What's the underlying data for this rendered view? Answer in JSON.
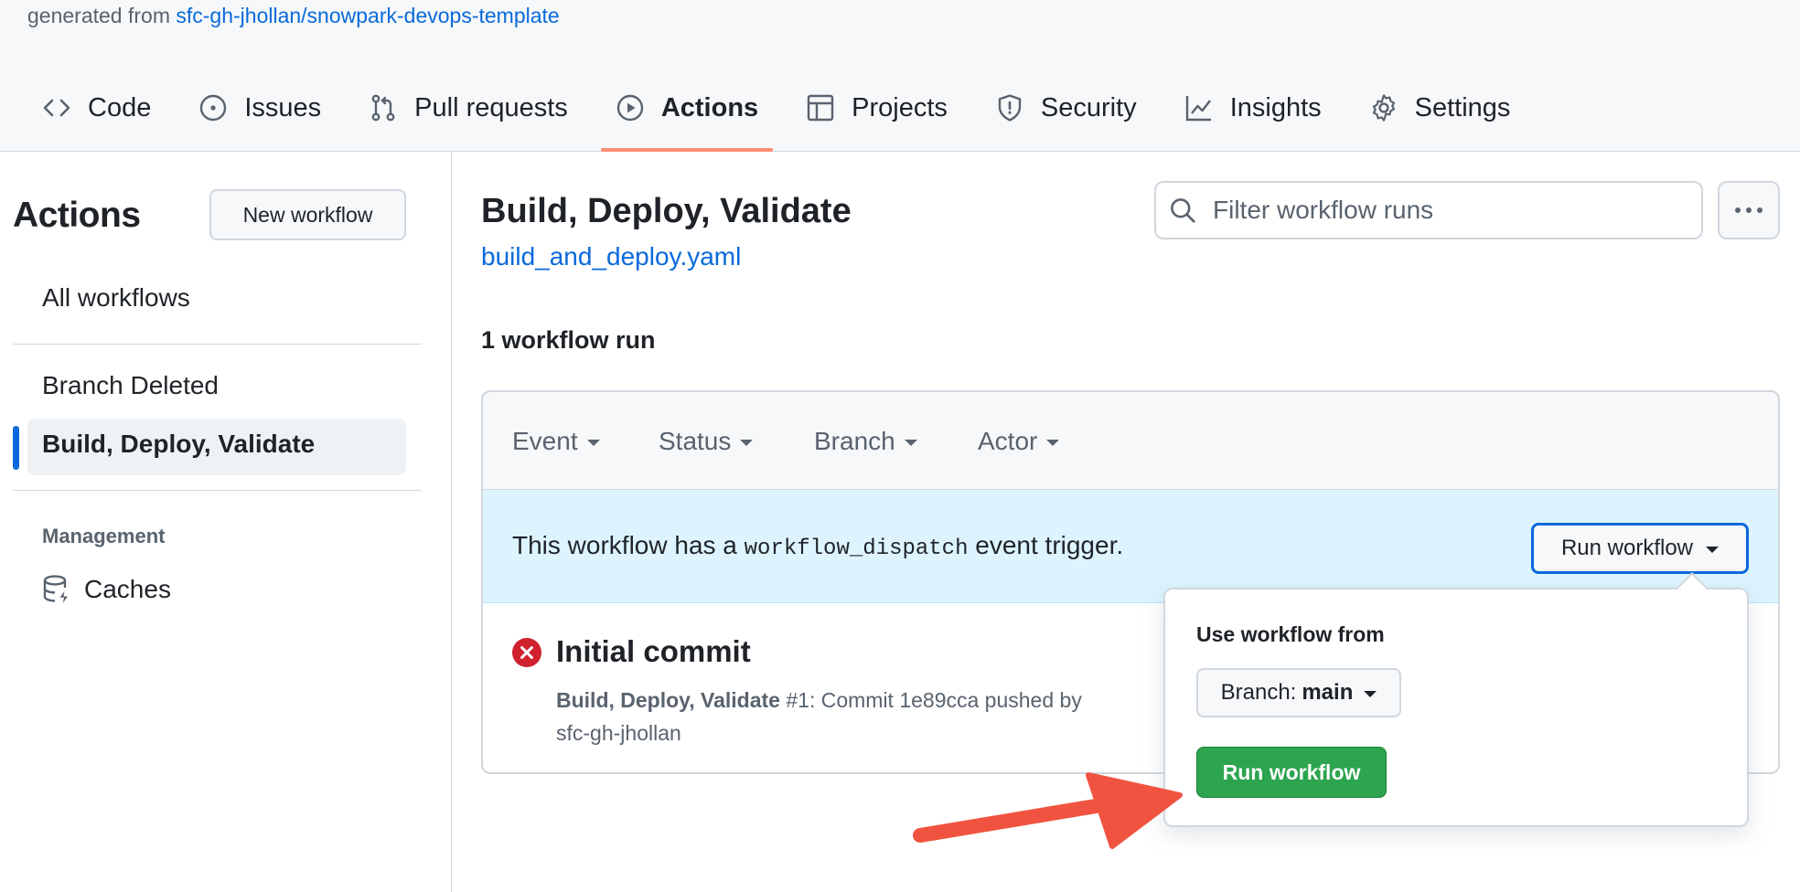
{
  "header": {
    "generated_prefix": "generated from ",
    "template_link": "sfc-gh-jhollan/snowpark-devops-template"
  },
  "repo_nav": {
    "tabs": [
      {
        "label": "Code",
        "icon": "code-icon"
      },
      {
        "label": "Issues",
        "icon": "issue-icon"
      },
      {
        "label": "Pull requests",
        "icon": "pull-request-icon"
      },
      {
        "label": "Actions",
        "icon": "play-icon",
        "active": true
      },
      {
        "label": "Projects",
        "icon": "table-icon"
      },
      {
        "label": "Security",
        "icon": "shield-icon"
      },
      {
        "label": "Insights",
        "icon": "graph-icon"
      },
      {
        "label": "Settings",
        "icon": "gear-icon"
      }
    ]
  },
  "sidebar": {
    "title": "Actions",
    "new_workflow_label": "New workflow",
    "all_workflows": "All workflows",
    "workflows": [
      "Branch Deleted",
      "Build, Deploy, Validate"
    ],
    "active_workflow": "Build, Deploy, Validate",
    "management_heading": "Management",
    "caches_label": "Caches",
    "caches_icon": "database-icon"
  },
  "main": {
    "title": "Build, Deploy, Validate",
    "file_link": "build_and_deploy.yaml",
    "filter_placeholder": "Filter workflow runs",
    "runs_count": "1 workflow run",
    "filters": [
      "Event",
      "Status",
      "Branch",
      "Actor"
    ],
    "dispatch": {
      "prefix": "This workflow has a ",
      "code": "workflow_dispatch",
      "suffix": " event trigger.",
      "button_label": "Run workflow"
    },
    "run": {
      "status": "failure",
      "title": "Initial commit",
      "workflow_name": "Build, Deploy, Validate",
      "meta_rest": " #1: Commit 1e89cca pushed by",
      "actor": "sfc-gh-jhollan"
    }
  },
  "popover": {
    "label": "Use workflow from",
    "branch_prefix": "Branch:",
    "branch_value": "main",
    "run_button_label": "Run workflow"
  },
  "colors": {
    "accent_blue": "#0969da",
    "active_underline": "#fd8c73",
    "success_green": "#2da44e",
    "failure_red": "#cf222e",
    "annotation_arrow": "#f0533f"
  }
}
